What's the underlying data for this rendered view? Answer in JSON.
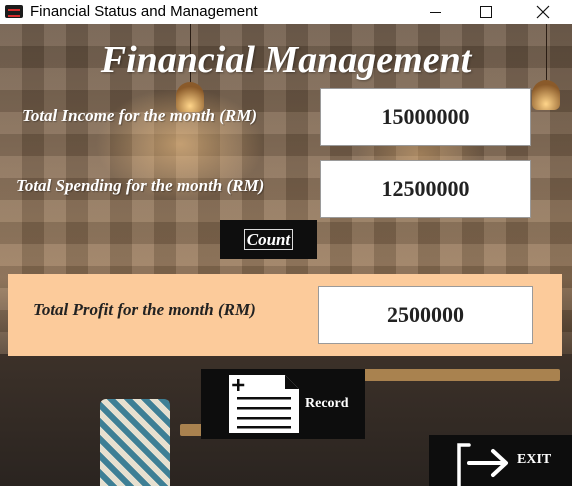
{
  "window": {
    "title": "Financial Status and Management"
  },
  "header": {
    "title": "Financial Management"
  },
  "income": {
    "label": "Total Income for the month (RM)",
    "value": "15000000"
  },
  "spending": {
    "label": "Total Spending for the month (RM)",
    "value": "12500000"
  },
  "count_button": {
    "label": "Count"
  },
  "profit": {
    "label": "Total Profit for the month (RM)",
    "value": "2500000"
  },
  "record_button": {
    "label": "Record",
    "icon": "document-add-icon"
  },
  "exit_button": {
    "label": "EXIT",
    "icon": "exit-arrow-icon"
  },
  "colors": {
    "profit_panel": "#fccb9b",
    "button_bg": "#0d0d0d"
  }
}
